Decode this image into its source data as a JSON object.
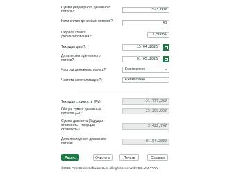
{
  "fields": {
    "payment": {
      "label_1": "Сумма регулярного денежного",
      "label_2": "потока?:",
      "value": "523,00₽"
    },
    "count": {
      "label_1": "Количество денежных потоков?:",
      "value": "48"
    },
    "rate": {
      "label_1": "Годовая ставка",
      "label_2": "дисконтирования?:",
      "value": "7,500Б$"
    },
    "current_date": {
      "label": "Текущая дата?:",
      "value": "15.04.2026"
    },
    "first_date": {
      "label_1": "Дата первого денежного",
      "label_2": "потока?:",
      "value": "01.05.2026"
    },
    "frequency": {
      "label": "Частота денежного потока?:",
      "value": "Ежемесячно"
    },
    "compounding": {
      "label": "Частота капитализации?:",
      "value": "Ежемесячно"
    }
  },
  "results": {
    "pv": {
      "label": "Текущая стоимость (PV):",
      "value": "21 777,28₽"
    },
    "fv": {
      "label_1": "Общая сумма денежных",
      "label_2": "потоков (FV):",
      "value": "25 209,00₽"
    },
    "discount": {
      "label_1": "Сумма дисконта (будущая",
      "label_2": "стоимость – текущая",
      "label_3": "стоимость):",
      "value": "3 422,74₽"
    },
    "last_date": {
      "label": "Дата последнего денежного",
      "label_2": "потока:",
      "value": "01.04.2030"
    }
  },
  "buttons": {
    "calc": "Рассч.",
    "clear": "Очистить",
    "print": "Печать",
    "help": "Справка"
  },
  "footer": "©2026 Pine Grove Software LLC, all rights reserved  #  DD.MM.YYYY",
  "colors": {
    "accent": "#1f7a46"
  }
}
